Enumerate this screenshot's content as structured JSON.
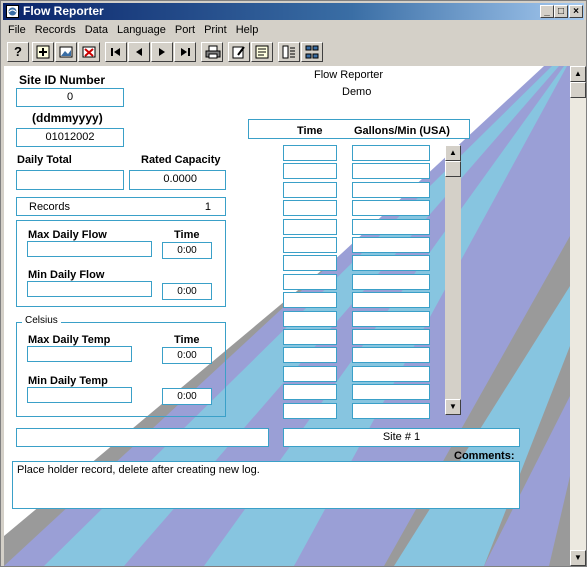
{
  "window": {
    "title": "Flow Reporter"
  },
  "menu": [
    "File",
    "Records",
    "Data",
    "Language",
    "Port",
    "Print",
    "Help"
  ],
  "toolbar": {
    "help_label": "?"
  },
  "header": {
    "app_name": "Flow Reporter",
    "subtitle": "Demo"
  },
  "site": {
    "label": "Site ID Number",
    "value": "0"
  },
  "date": {
    "label": "(ddmmyyyy)",
    "value": "01012002"
  },
  "daily_total": {
    "label": "Daily Total",
    "value": ""
  },
  "rated_capacity": {
    "label": "Rated Capacity",
    "value": "0.0000"
  },
  "records": {
    "label": "Records",
    "count": "1"
  },
  "flow": {
    "max_label": "Max Daily Flow",
    "max_value": "",
    "max_time_label": "Time",
    "max_time": "0:00",
    "min_label": "Min Daily Flow",
    "min_value": "",
    "min_time": "0:00"
  },
  "temp": {
    "unit_label": "Celsius",
    "max_label": "Max Daily Temp",
    "max_value": "",
    "max_time_label": "Time",
    "max_time": "0:00",
    "min_label": "Min Daily Temp",
    "min_value": "",
    "min_time": "0:00"
  },
  "table": {
    "col_time": "Time",
    "col_gallons": "Gallons/Min (USA)"
  },
  "site_name": "Site # 1",
  "comments": {
    "label": "Comments:",
    "text": "Place holder record, delete after creating new log."
  },
  "colors": {
    "title_start": "#0a246a",
    "border_accent": "#3aa0c8",
    "stripe_blue": "#87c5e0",
    "stripe_purple": "#9a9fd6",
    "stripe_gray": "#9a9a9a"
  }
}
